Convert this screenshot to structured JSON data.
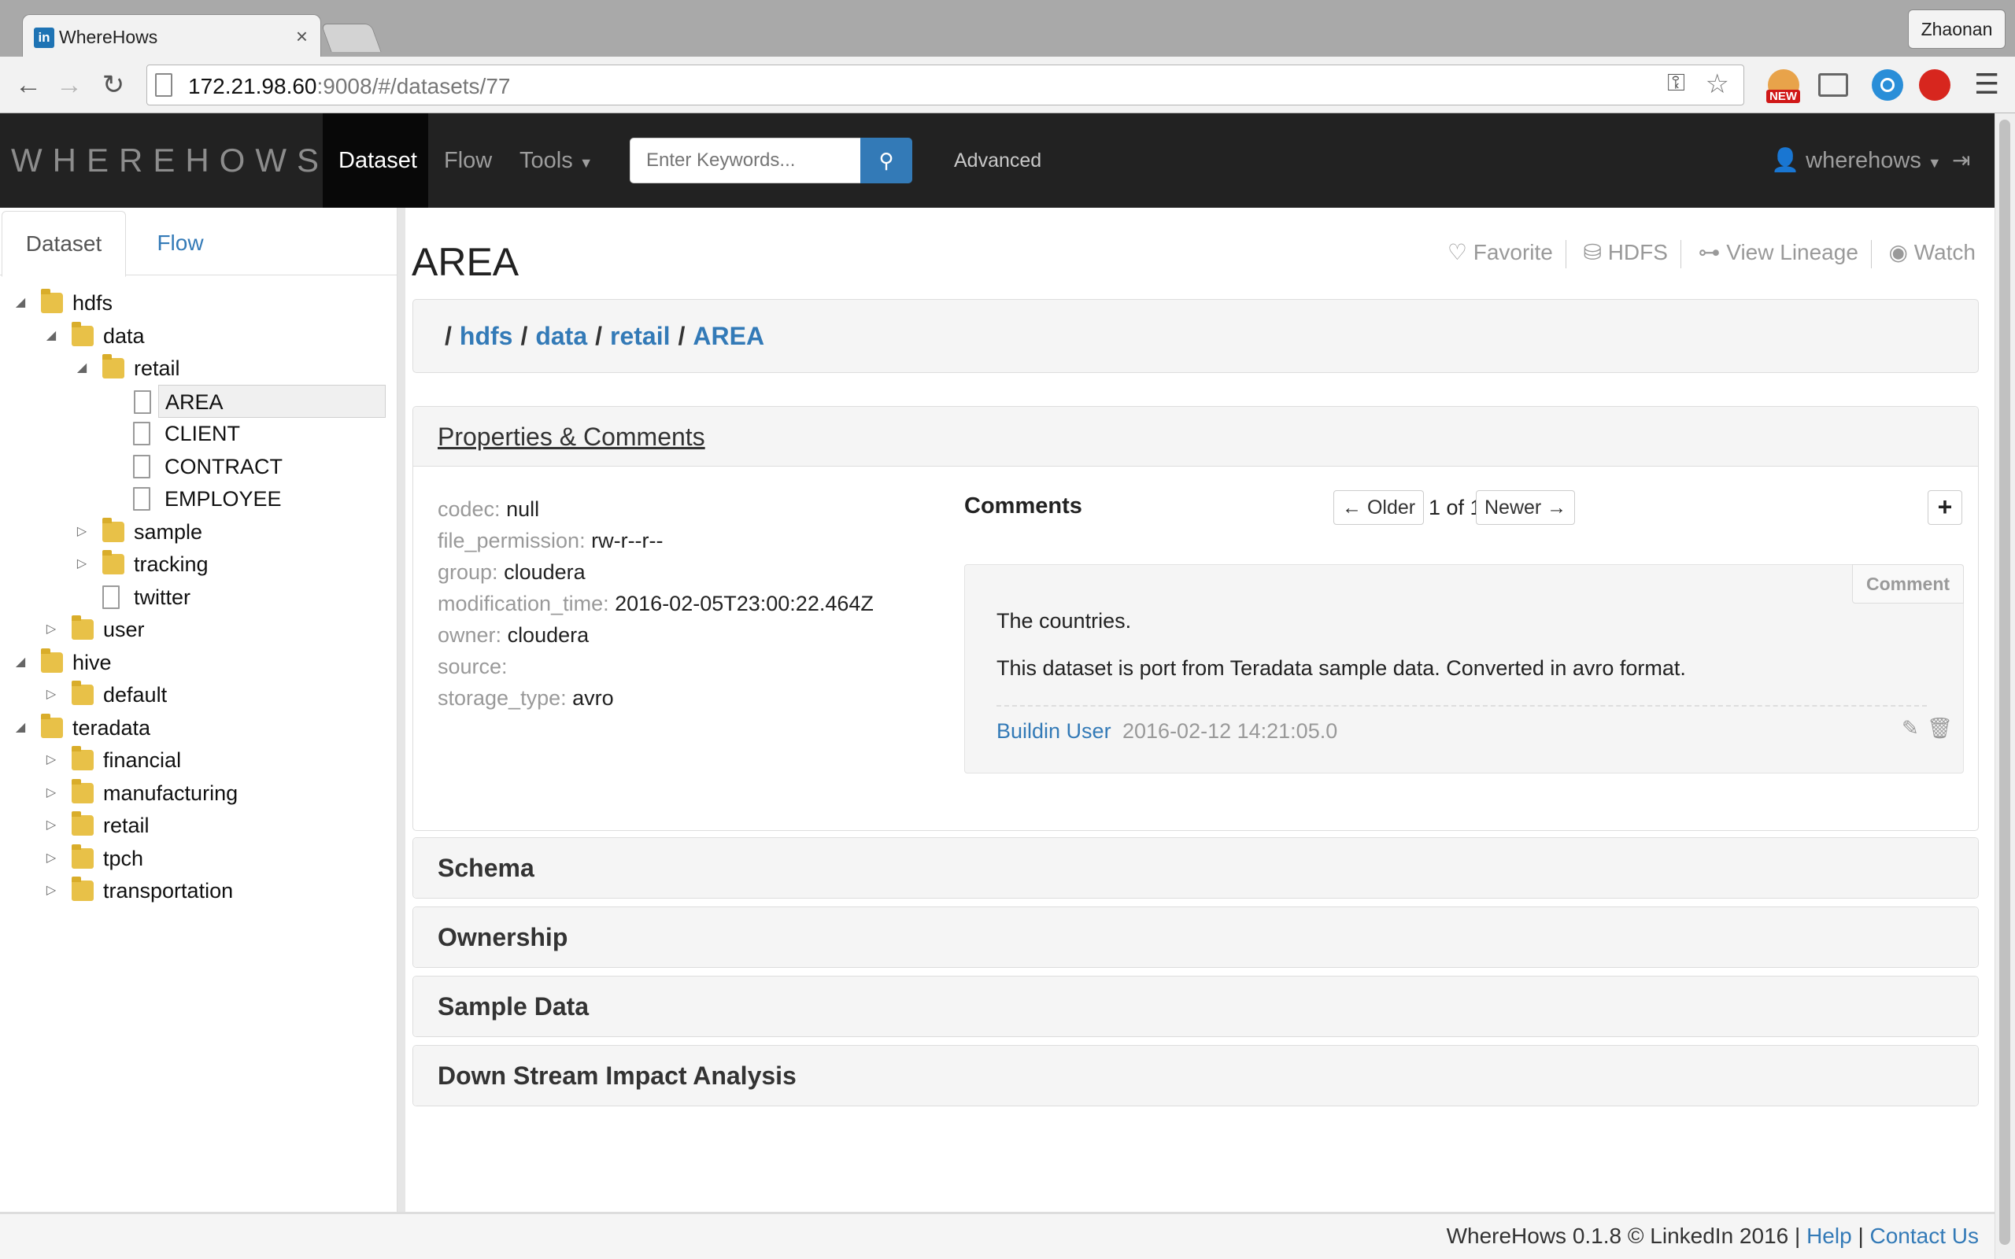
{
  "browser": {
    "tab_title": "WhereHows",
    "tab_favicon_text": "in",
    "profile_name": "Zhaonan",
    "url_host": "172.21.98.60",
    "url_rest": ":9008/#/datasets/77",
    "ext_new_badge": "NEW"
  },
  "navbar": {
    "brand": "WHEREHOWS",
    "dataset": "Dataset",
    "flow": "Flow",
    "tools": "Tools",
    "search_placeholder": "Enter Keywords...",
    "advanced": "Advanced",
    "user": "wherehows"
  },
  "sidebar": {
    "tab_dataset": "Dataset",
    "tab_flow": "Flow",
    "tree": [
      {
        "label": "hdfs",
        "depth": 0,
        "kind": "folder",
        "arrow": "open"
      },
      {
        "label": "data",
        "depth": 1,
        "kind": "folder",
        "arrow": "open"
      },
      {
        "label": "retail",
        "depth": 2,
        "kind": "folder",
        "arrow": "open"
      },
      {
        "label": "AREA",
        "depth": 3,
        "kind": "file",
        "arrow": "none",
        "selected": true
      },
      {
        "label": "CLIENT",
        "depth": 3,
        "kind": "file",
        "arrow": "none"
      },
      {
        "label": "CONTRACT",
        "depth": 3,
        "kind": "file",
        "arrow": "none"
      },
      {
        "label": "EMPLOYEE",
        "depth": 3,
        "kind": "file",
        "arrow": "none"
      },
      {
        "label": "sample",
        "depth": 2,
        "kind": "folder",
        "arrow": "closed"
      },
      {
        "label": "tracking",
        "depth": 2,
        "kind": "folder",
        "arrow": "closed"
      },
      {
        "label": "twitter",
        "depth": 2,
        "kind": "file",
        "arrow": "none"
      },
      {
        "label": "user",
        "depth": 1,
        "kind": "folder",
        "arrow": "closed"
      },
      {
        "label": "hive",
        "depth": 0,
        "kind": "folder",
        "arrow": "open"
      },
      {
        "label": "default",
        "depth": 1,
        "kind": "folder",
        "arrow": "closed"
      },
      {
        "label": "teradata",
        "depth": 0,
        "kind": "folder",
        "arrow": "open"
      },
      {
        "label": "financial",
        "depth": 1,
        "kind": "folder",
        "arrow": "closed"
      },
      {
        "label": "manufacturing",
        "depth": 1,
        "kind": "folder",
        "arrow": "closed"
      },
      {
        "label": "retail",
        "depth": 1,
        "kind": "folder",
        "arrow": "closed"
      },
      {
        "label": "tpch",
        "depth": 1,
        "kind": "folder",
        "arrow": "closed"
      },
      {
        "label": "transportation",
        "depth": 1,
        "kind": "folder",
        "arrow": "closed"
      }
    ]
  },
  "main": {
    "title": "AREA",
    "actions": {
      "favorite": "Favorite",
      "hdfs": "HDFS",
      "lineage": "View Lineage",
      "watch": "Watch"
    },
    "breadcrumb": [
      "hdfs",
      "data",
      "retail",
      "AREA"
    ],
    "properties_title": "Properties & Comments",
    "properties": [
      {
        "key": "codec:",
        "value": "null"
      },
      {
        "key": "file_permission:",
        "value": "rw-r--r--"
      },
      {
        "key": "group:",
        "value": "cloudera"
      },
      {
        "key": "modification_time:",
        "value": "2016-02-05T23:00:22.464Z"
      },
      {
        "key": "owner:",
        "value": "cloudera"
      },
      {
        "key": "source:",
        "value": ""
      },
      {
        "key": "storage_type:",
        "value": "avro"
      }
    ],
    "comments": {
      "heading": "Comments",
      "older": "← Older",
      "count": "1 of 1",
      "newer": "Newer →",
      "add": "+",
      "tag": "Comment",
      "paragraph1": "The countries.",
      "paragraph2": "This dataset is port from Teradata sample data. Converted in avro format.",
      "author": "Buildin User",
      "date": "2016-02-12 14:21:05.0"
    },
    "sections": {
      "schema": "Schema",
      "ownership": "Ownership",
      "sample": "Sample Data",
      "downstream": "Down Stream Impact Analysis"
    }
  },
  "footer": {
    "text": "WhereHows 0.1.8 © LinkedIn 2016 |",
    "help": "Help",
    "sep": "|",
    "contact": "Contact Us"
  }
}
